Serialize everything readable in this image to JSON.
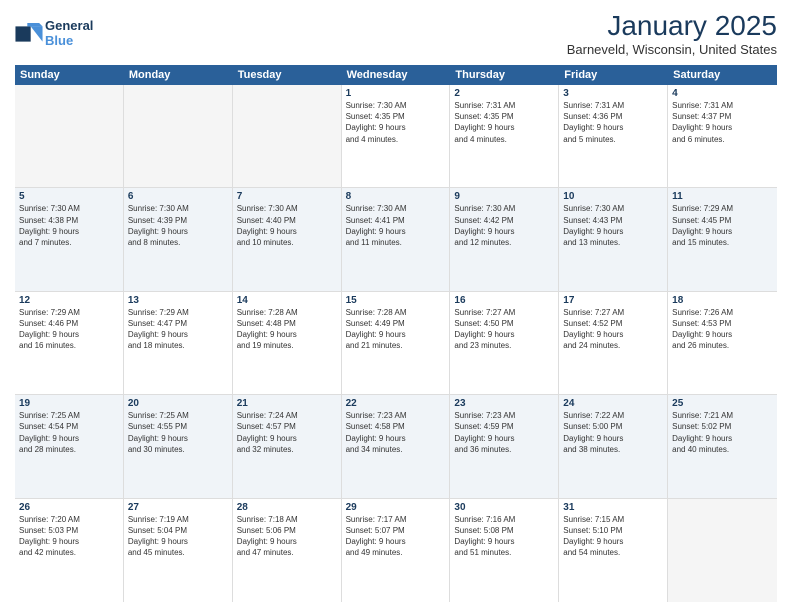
{
  "logo": {
    "text_general": "General",
    "text_blue": "Blue"
  },
  "header": {
    "month": "January 2025",
    "location": "Barneveld, Wisconsin, United States"
  },
  "days_of_week": [
    "Sunday",
    "Monday",
    "Tuesday",
    "Wednesday",
    "Thursday",
    "Friday",
    "Saturday"
  ],
  "weeks": [
    [
      {
        "day": "",
        "content": ""
      },
      {
        "day": "",
        "content": ""
      },
      {
        "day": "",
        "content": ""
      },
      {
        "day": "1",
        "content": "Sunrise: 7:30 AM\nSunset: 4:35 PM\nDaylight: 9 hours\nand 4 minutes."
      },
      {
        "day": "2",
        "content": "Sunrise: 7:31 AM\nSunset: 4:35 PM\nDaylight: 9 hours\nand 4 minutes."
      },
      {
        "day": "3",
        "content": "Sunrise: 7:31 AM\nSunset: 4:36 PM\nDaylight: 9 hours\nand 5 minutes."
      },
      {
        "day": "4",
        "content": "Sunrise: 7:31 AM\nSunset: 4:37 PM\nDaylight: 9 hours\nand 6 minutes."
      }
    ],
    [
      {
        "day": "5",
        "content": "Sunrise: 7:30 AM\nSunset: 4:38 PM\nDaylight: 9 hours\nand 7 minutes."
      },
      {
        "day": "6",
        "content": "Sunrise: 7:30 AM\nSunset: 4:39 PM\nDaylight: 9 hours\nand 8 minutes."
      },
      {
        "day": "7",
        "content": "Sunrise: 7:30 AM\nSunset: 4:40 PM\nDaylight: 9 hours\nand 10 minutes."
      },
      {
        "day": "8",
        "content": "Sunrise: 7:30 AM\nSunset: 4:41 PM\nDaylight: 9 hours\nand 11 minutes."
      },
      {
        "day": "9",
        "content": "Sunrise: 7:30 AM\nSunset: 4:42 PM\nDaylight: 9 hours\nand 12 minutes."
      },
      {
        "day": "10",
        "content": "Sunrise: 7:30 AM\nSunset: 4:43 PM\nDaylight: 9 hours\nand 13 minutes."
      },
      {
        "day": "11",
        "content": "Sunrise: 7:29 AM\nSunset: 4:45 PM\nDaylight: 9 hours\nand 15 minutes."
      }
    ],
    [
      {
        "day": "12",
        "content": "Sunrise: 7:29 AM\nSunset: 4:46 PM\nDaylight: 9 hours\nand 16 minutes."
      },
      {
        "day": "13",
        "content": "Sunrise: 7:29 AM\nSunset: 4:47 PM\nDaylight: 9 hours\nand 18 minutes."
      },
      {
        "day": "14",
        "content": "Sunrise: 7:28 AM\nSunset: 4:48 PM\nDaylight: 9 hours\nand 19 minutes."
      },
      {
        "day": "15",
        "content": "Sunrise: 7:28 AM\nSunset: 4:49 PM\nDaylight: 9 hours\nand 21 minutes."
      },
      {
        "day": "16",
        "content": "Sunrise: 7:27 AM\nSunset: 4:50 PM\nDaylight: 9 hours\nand 23 minutes."
      },
      {
        "day": "17",
        "content": "Sunrise: 7:27 AM\nSunset: 4:52 PM\nDaylight: 9 hours\nand 24 minutes."
      },
      {
        "day": "18",
        "content": "Sunrise: 7:26 AM\nSunset: 4:53 PM\nDaylight: 9 hours\nand 26 minutes."
      }
    ],
    [
      {
        "day": "19",
        "content": "Sunrise: 7:25 AM\nSunset: 4:54 PM\nDaylight: 9 hours\nand 28 minutes."
      },
      {
        "day": "20",
        "content": "Sunrise: 7:25 AM\nSunset: 4:55 PM\nDaylight: 9 hours\nand 30 minutes."
      },
      {
        "day": "21",
        "content": "Sunrise: 7:24 AM\nSunset: 4:57 PM\nDaylight: 9 hours\nand 32 minutes."
      },
      {
        "day": "22",
        "content": "Sunrise: 7:23 AM\nSunset: 4:58 PM\nDaylight: 9 hours\nand 34 minutes."
      },
      {
        "day": "23",
        "content": "Sunrise: 7:23 AM\nSunset: 4:59 PM\nDaylight: 9 hours\nand 36 minutes."
      },
      {
        "day": "24",
        "content": "Sunrise: 7:22 AM\nSunset: 5:00 PM\nDaylight: 9 hours\nand 38 minutes."
      },
      {
        "day": "25",
        "content": "Sunrise: 7:21 AM\nSunset: 5:02 PM\nDaylight: 9 hours\nand 40 minutes."
      }
    ],
    [
      {
        "day": "26",
        "content": "Sunrise: 7:20 AM\nSunset: 5:03 PM\nDaylight: 9 hours\nand 42 minutes."
      },
      {
        "day": "27",
        "content": "Sunrise: 7:19 AM\nSunset: 5:04 PM\nDaylight: 9 hours\nand 45 minutes."
      },
      {
        "day": "28",
        "content": "Sunrise: 7:18 AM\nSunset: 5:06 PM\nDaylight: 9 hours\nand 47 minutes."
      },
      {
        "day": "29",
        "content": "Sunrise: 7:17 AM\nSunset: 5:07 PM\nDaylight: 9 hours\nand 49 minutes."
      },
      {
        "day": "30",
        "content": "Sunrise: 7:16 AM\nSunset: 5:08 PM\nDaylight: 9 hours\nand 51 minutes."
      },
      {
        "day": "31",
        "content": "Sunrise: 7:15 AM\nSunset: 5:10 PM\nDaylight: 9 hours\nand 54 minutes."
      },
      {
        "day": "",
        "content": ""
      }
    ]
  ]
}
